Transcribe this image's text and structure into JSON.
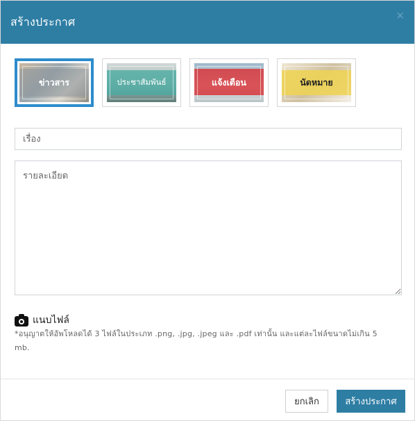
{
  "header": {
    "title": "สร้างประกาศ",
    "close_label": "×"
  },
  "types": [
    {
      "label": "ข่าวสาร",
      "selected": true
    },
    {
      "label": "ประชาสัมพันธ์",
      "selected": false
    },
    {
      "label": "แจ้งเตือน",
      "selected": false
    },
    {
      "label": "นัดหมาย",
      "selected": false
    }
  ],
  "form": {
    "title_placeholder": "เรื่อง",
    "title_value": "",
    "detail_placeholder": "รายละเอียด",
    "detail_value": ""
  },
  "attachment": {
    "icon": "camera-icon",
    "label": "แนบไฟล์",
    "note": "*อนุญาตให้อัพโหลดได้ 3 ไฟล์ในประเภท .png, .jpg, .jpeg และ .pdf เท่านั้น และแต่ละไฟล์ขนาดไม่เกิน 5 mb."
  },
  "footer": {
    "cancel_label": "ยกเลิก",
    "submit_label": "สร้างประกาศ"
  },
  "colors": {
    "header_bg": "#2e7ea4",
    "selected_border": "#2d8ccb",
    "submit_bg": "#2e7ea4"
  }
}
